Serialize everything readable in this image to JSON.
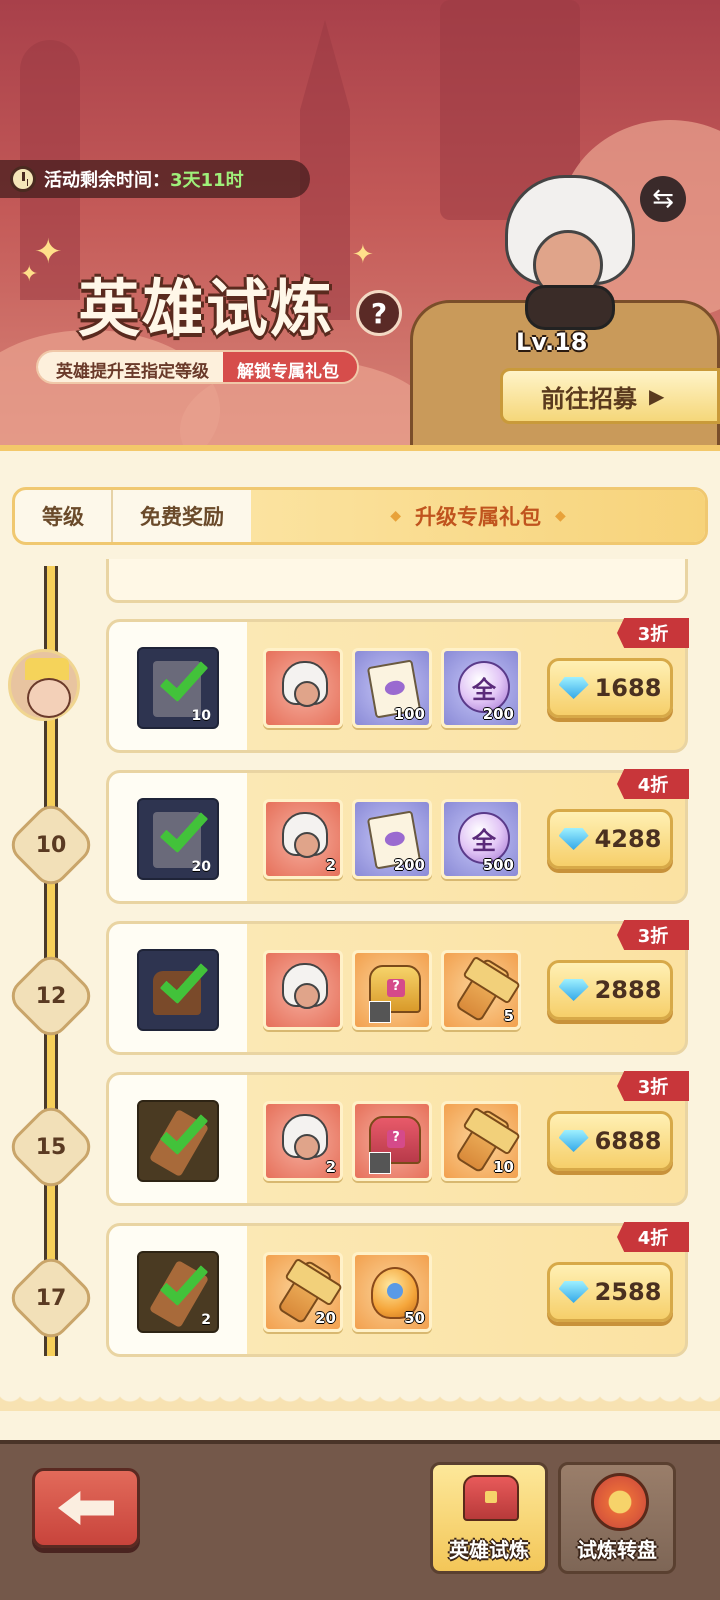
{
  "event": {
    "timer_label": "活动剩余时间：",
    "timer_value": "3天11时",
    "title": "英雄试炼",
    "help_icon": "?",
    "subtitle_left": "英雄提升至指定等级",
    "subtitle_right": "解锁专属礼包"
  },
  "hero": {
    "level": "Lv.18",
    "swap_icon": "⇆",
    "recruit_label": "前往招募"
  },
  "tabs": {
    "level": "等级",
    "free": "免费奖励",
    "exclusive": "升级专属礼包"
  },
  "packs": [
    {
      "level": "",
      "discount": "3折",
      "claimed_item": {
        "icon": "integral-book-icon",
        "count": "10"
      },
      "rewards": [
        {
          "icon": "hero-shard-icon",
          "color": "red",
          "qty": ""
        },
        {
          "icon": "integral-scroll-icon",
          "color": "purple",
          "qty": "100"
        },
        {
          "icon": "universal-orb-icon",
          "color": "purple",
          "qty": "200",
          "glyph": "全"
        }
      ],
      "price": "1688"
    },
    {
      "level": "10",
      "discount": "4折",
      "claimed_item": {
        "icon": "integral-book-icon",
        "count": "20"
      },
      "rewards": [
        {
          "icon": "hero-shard-icon",
          "color": "red",
          "qty": "2"
        },
        {
          "icon": "integral-scroll-icon",
          "color": "purple",
          "qty": "200"
        },
        {
          "icon": "universal-orb-icon",
          "color": "purple",
          "qty": "500",
          "glyph": "全"
        }
      ],
      "price": "4288"
    },
    {
      "level": "12",
      "discount": "3折",
      "claimed_item": {
        "icon": "treasure-chest-icon",
        "count": ""
      },
      "rewards": [
        {
          "icon": "hero-shard-icon",
          "color": "red",
          "qty": ""
        },
        {
          "icon": "gold-chest-icon",
          "color": "orange",
          "qty": ""
        },
        {
          "icon": "hammer-icon",
          "color": "orange",
          "qty": "5"
        }
      ],
      "price": "2888"
    },
    {
      "level": "15",
      "discount": "3折",
      "claimed_item": {
        "icon": "hammer-icon",
        "count": ""
      },
      "rewards": [
        {
          "icon": "hero-shard-icon",
          "color": "red",
          "qty": "2"
        },
        {
          "icon": "red-chest-icon",
          "color": "red",
          "qty": ""
        },
        {
          "icon": "hammer-icon",
          "color": "orange",
          "qty": "10"
        }
      ],
      "price": "6888"
    },
    {
      "level": "17",
      "discount": "4折",
      "claimed_item": {
        "icon": "hammer-icon",
        "count": "2"
      },
      "rewards": [
        {
          "icon": "hammer-icon",
          "color": "orange",
          "qty": "20"
        },
        {
          "icon": "amber-crystal-icon",
          "color": "orange",
          "qty": "50"
        }
      ],
      "price": "2588"
    }
  ],
  "bottom_nav": {
    "active_label": "英雄试炼",
    "inactive_label": "试炼转盘"
  },
  "colors": {
    "accent": "#f6cf6a",
    "discount_red": "#c8363a",
    "check_green": "#42c23a",
    "tab_active_text": "#c0541e"
  }
}
